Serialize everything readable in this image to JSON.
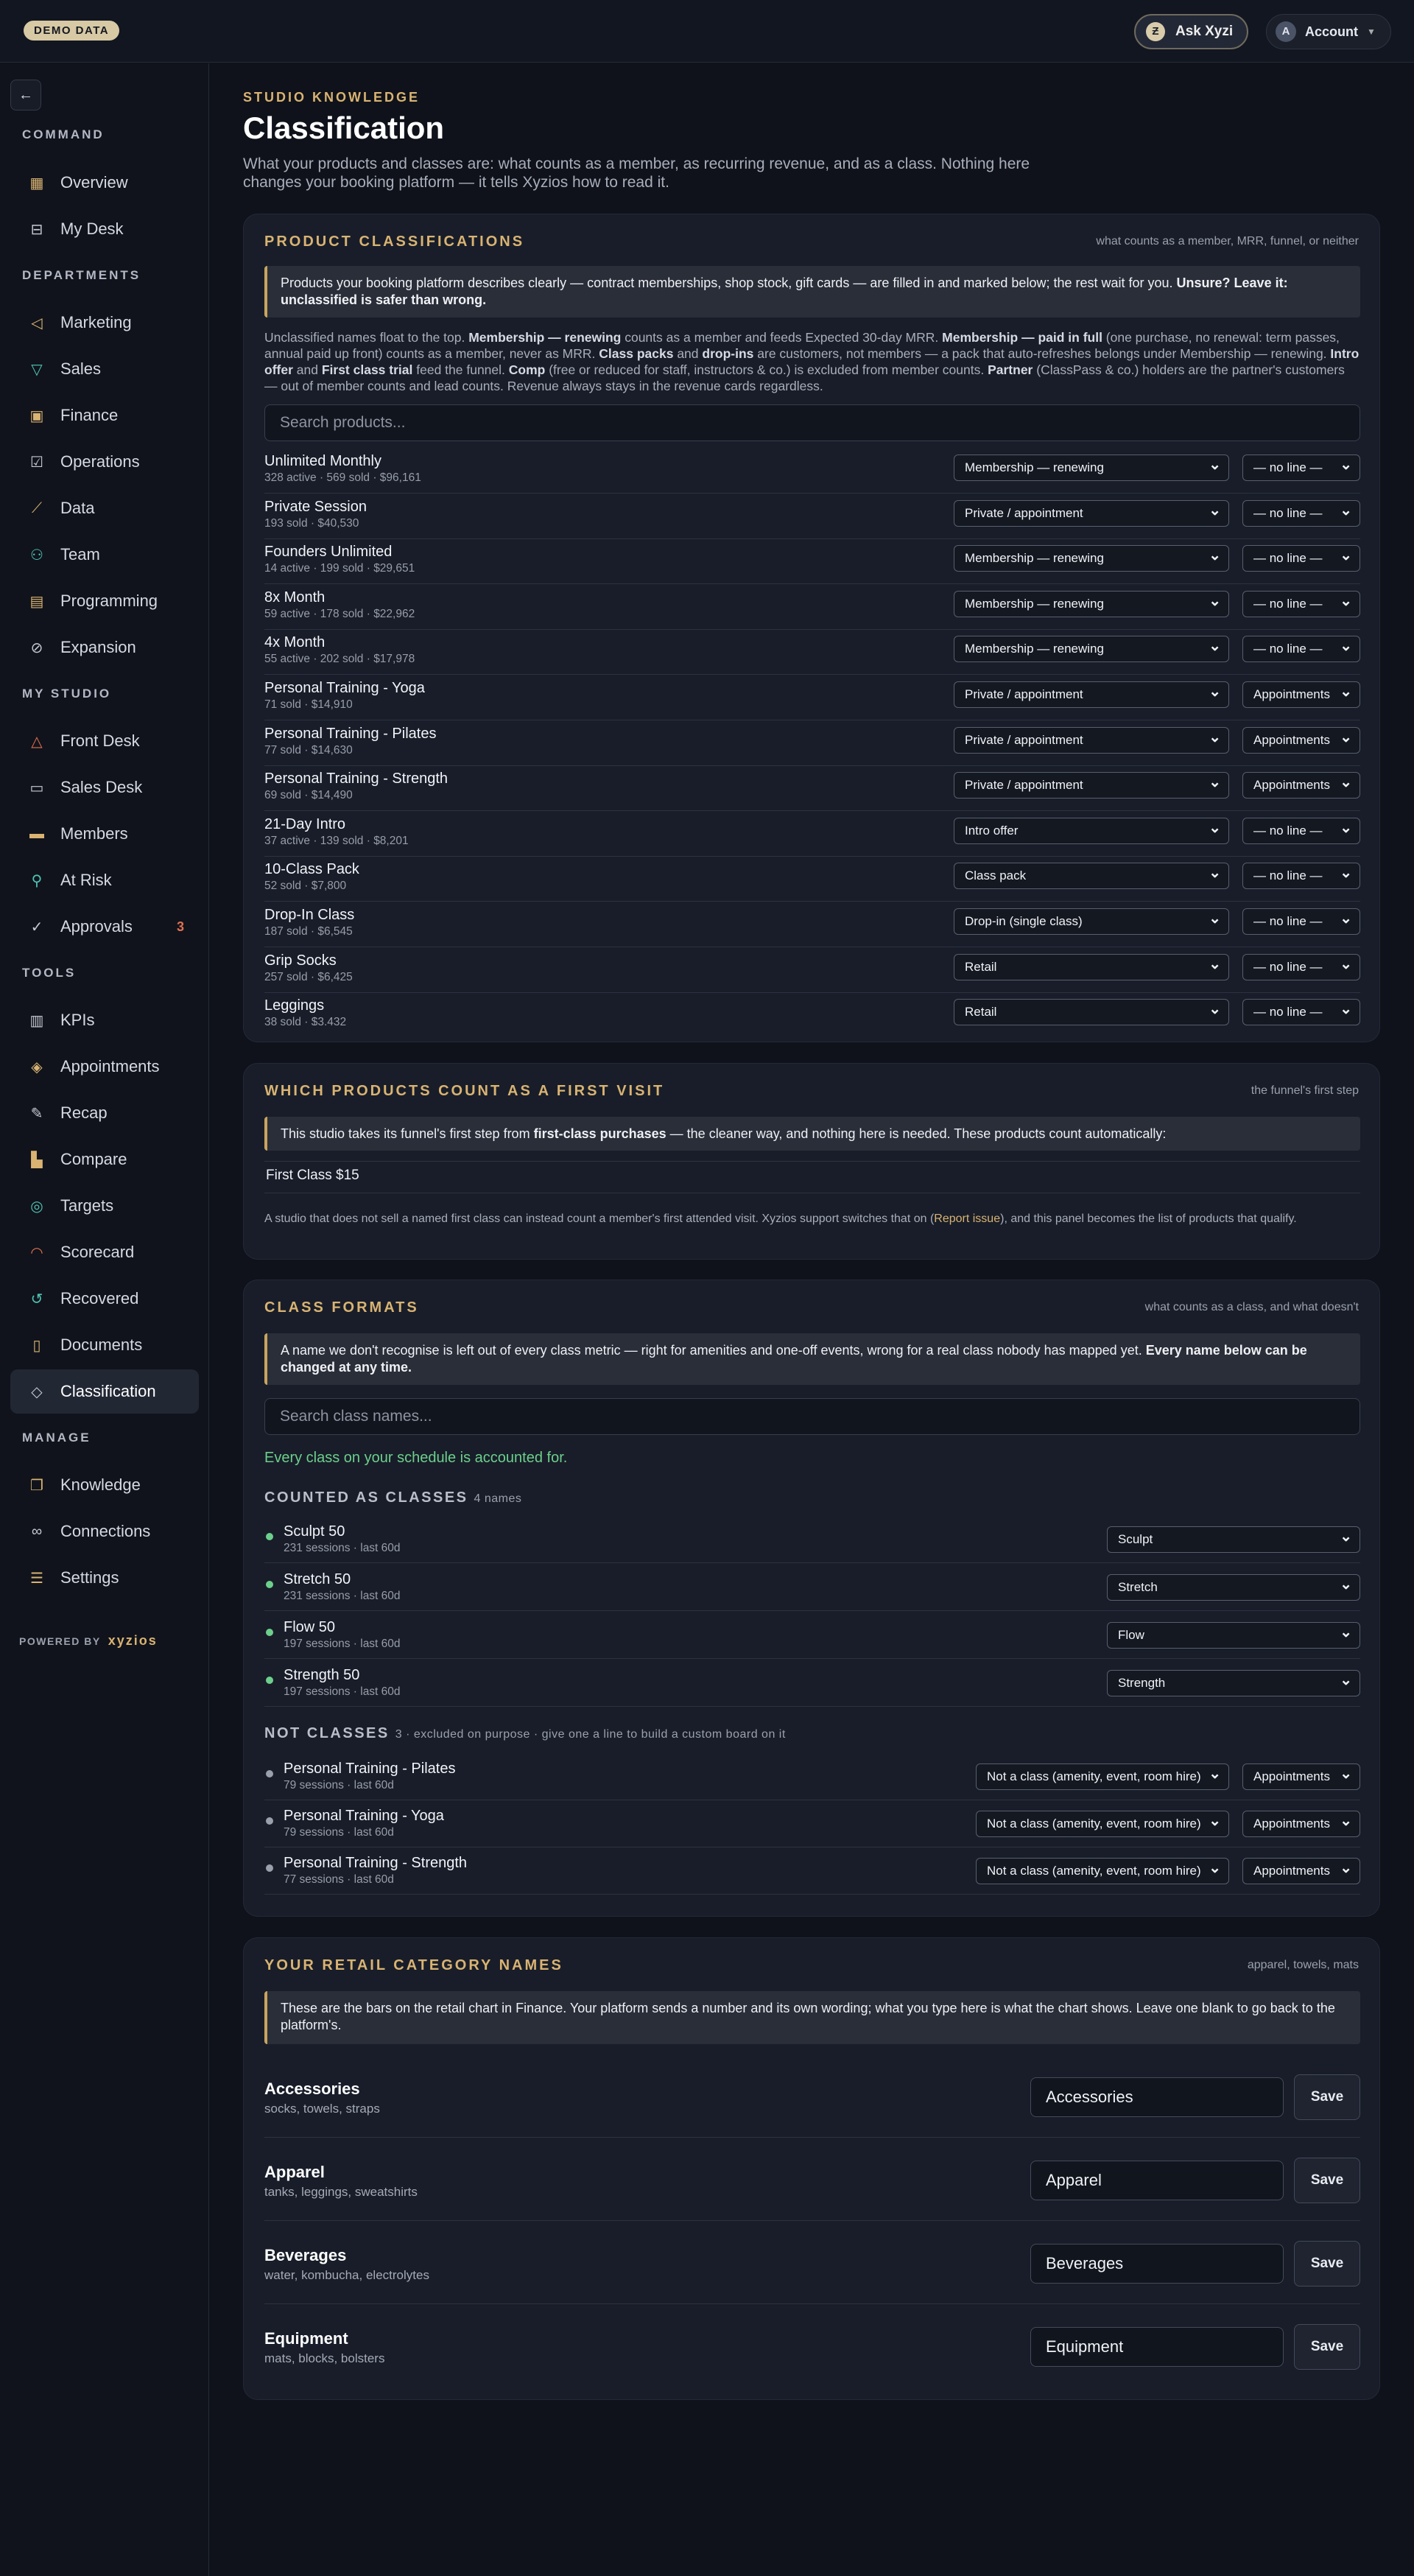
{
  "topbar": {
    "demo_badge": "DEMO DATA",
    "ask_label": "Ask Xyzi",
    "account_initial": "A",
    "account_label": "Account"
  },
  "sidebar": {
    "sections": {
      "command": "COMMAND",
      "departments": "DEPARTMENTS",
      "my_studio": "MY STUDIO",
      "tools": "TOOLS",
      "manage": "MANAGE"
    },
    "items": [
      {
        "label": "Overview",
        "icon": "grid-icon"
      },
      {
        "label": "My Desk",
        "icon": "inbox-icon"
      },
      {
        "label": "Marketing",
        "icon": "megaphone-icon"
      },
      {
        "label": "Sales",
        "icon": "funnel-icon"
      },
      {
        "label": "Finance",
        "icon": "banknote-icon"
      },
      {
        "label": "Operations",
        "icon": "clipboard-check-icon"
      },
      {
        "label": "Data",
        "icon": "line-chart-icon"
      },
      {
        "label": "Team",
        "icon": "users-icon"
      },
      {
        "label": "Programming",
        "icon": "calendar-icon"
      },
      {
        "label": "Expansion",
        "icon": "compass-icon"
      },
      {
        "label": "Front Desk",
        "icon": "bell-icon"
      },
      {
        "label": "Sales Desk",
        "icon": "chat-icon"
      },
      {
        "label": "Members",
        "icon": "id-card-icon"
      },
      {
        "label": "At Risk",
        "icon": "user-alert-icon"
      },
      {
        "label": "Approvals",
        "icon": "check-circle-icon",
        "badge": "3"
      },
      {
        "label": "KPIs",
        "icon": "bars-icon"
      },
      {
        "label": "Appointments",
        "icon": "layers-icon"
      },
      {
        "label": "Recap",
        "icon": "pencil-square-icon"
      },
      {
        "label": "Compare",
        "icon": "bar-chart-icon"
      },
      {
        "label": "Targets",
        "icon": "target-icon"
      },
      {
        "label": "Scorecard",
        "icon": "gauge-icon"
      },
      {
        "label": "Recovered",
        "icon": "refresh-circle-icon"
      },
      {
        "label": "Documents",
        "icon": "document-icon"
      },
      {
        "label": "Classification",
        "icon": "tag-icon"
      },
      {
        "label": "Knowledge",
        "icon": "book-icon"
      },
      {
        "label": "Connections",
        "icon": "link-icon"
      },
      {
        "label": "Settings",
        "icon": "sliders-icon"
      }
    ],
    "powered_by": "POWERED BY",
    "brand": "xyzios"
  },
  "page": {
    "eyebrow": "STUDIO KNOWLEDGE",
    "title": "Classification",
    "subtitle": "What your products and classes are: what counts as a member, as recurring revenue, and as a class. Nothing here changes your booking platform — it tells Xyzios how to read it."
  },
  "products": {
    "heading": "PRODUCT CLASSIFICATIONS",
    "right_note": "what counts as a member, MRR, funnel, or neither",
    "callout_text": "Products your booking platform describes clearly — contract memberships, shop stock, gift cards — are filled in and marked below; the rest wait for you. ",
    "callout_bold": "Unsure? Leave it: unclassified is safer than wrong.",
    "help_parts": [
      "Unclassified names float to the top. ",
      "Membership — renewing",
      " counts as a member and feeds Expected 30-day MRR. ",
      "Membership — paid in full",
      " (one purchase, no renewal: term passes, annual paid up front) counts as a member, never as MRR. ",
      "Class packs",
      " and ",
      "drop-ins",
      " are customers, not members — a pack that auto-refreshes belongs under Membership — renewing. ",
      "Intro offer",
      " and ",
      "First class trial",
      " feed the funnel. ",
      "Comp",
      " (free or reduced for staff, instructors & co.) is excluded from member counts. ",
      "Partner",
      " (ClassPass & co.) holders are the partner's customers — out of member counts and lead counts. Revenue always stays in the revenue cards regardless."
    ],
    "search_placeholder": "Search products...",
    "rows": [
      {
        "name": "Unlimited Monthly",
        "meta": "328 active · 569 sold · $96,161",
        "type": "Membership — renewing",
        "line": "— no line —"
      },
      {
        "name": "Private Session",
        "meta": "193 sold · $40,530",
        "type": "Private / appointment",
        "line": "— no line —"
      },
      {
        "name": "Founders Unlimited",
        "meta": "14 active · 199 sold · $29,651",
        "type": "Membership — renewing",
        "line": "— no line —"
      },
      {
        "name": "8x Month",
        "meta": "59 active · 178 sold · $22,962",
        "type": "Membership — renewing",
        "line": "— no line —"
      },
      {
        "name": "4x Month",
        "meta": "55 active · 202 sold · $17,978",
        "type": "Membership — renewing",
        "line": "— no line —"
      },
      {
        "name": "Personal Training - Yoga",
        "meta": "71 sold · $14,910",
        "type": "Private / appointment",
        "line": "Appointments"
      },
      {
        "name": "Personal Training - Pilates",
        "meta": "77 sold · $14,630",
        "type": "Private / appointment",
        "line": "Appointments"
      },
      {
        "name": "Personal Training - Strength",
        "meta": "69 sold · $14,490",
        "type": "Private / appointment",
        "line": "Appointments"
      },
      {
        "name": "21-Day Intro",
        "meta": "37 active · 139 sold · $8,201",
        "type": "Intro offer",
        "line": "— no line —"
      },
      {
        "name": "10-Class Pack",
        "meta": "52 sold · $7,800",
        "type": "Class pack",
        "line": "— no line —"
      },
      {
        "name": "Drop-In Class",
        "meta": "187 sold · $6,545",
        "type": "Drop-in (single class)",
        "line": "— no line —"
      },
      {
        "name": "Grip Socks",
        "meta": "257 sold · $6,425",
        "type": "Retail",
        "line": "— no line —"
      },
      {
        "name": "Leggings",
        "meta": "38 sold · $3,432",
        "type": "Retail",
        "line": "— no line —"
      }
    ]
  },
  "first_visit": {
    "heading": "WHICH PRODUCTS COUNT AS A FIRST VISIT",
    "right_note": "the funnel's first step",
    "callout_pre": "This studio takes its funnel's first step from ",
    "callout_bold": "first-class purchases",
    "callout_post": " — the cleaner way, and nothing here is needed. These products count automatically:",
    "item": "First Class $15",
    "note_pre": "A studio that does not sell a named first class can instead count a member's first attended visit. Xyzios support switches that on (",
    "note_link": "Report issue",
    "note_post": "), and this panel becomes the list of products that qualify."
  },
  "class_formats": {
    "heading": "CLASS FORMATS",
    "right_note": "what counts as a class, and what doesn't",
    "callout_text": "A name we don't recognise is left out of every class metric — right for amenities and one-off events, wrong for a real class nobody has mapped yet. ",
    "callout_bold": "Every name below can be changed at any time.",
    "search_placeholder": "Search class names...",
    "ok_message": "Every class on your schedule is accounted for.",
    "counted_title": "COUNTED AS CLASSES",
    "counted_count": "4 names",
    "counted": [
      {
        "name": "Sculpt 50",
        "meta": "231 sessions · last 60d",
        "format": "Sculpt"
      },
      {
        "name": "Stretch 50",
        "meta": "231 sessions · last 60d",
        "format": "Stretch"
      },
      {
        "name": "Flow 50",
        "meta": "197 sessions · last 60d",
        "format": "Flow"
      },
      {
        "name": "Strength 50",
        "meta": "197 sessions · last 60d",
        "format": "Strength"
      }
    ],
    "not_title": "NOT CLASSES",
    "not_note": "3 · excluded on purpose · give one a line to build a custom board on it",
    "not_classes": [
      {
        "name": "Personal Training - Pilates",
        "meta": "79 sessions · last 60d",
        "format": "Not a class (amenity, event, room hire)",
        "line": "Appointments"
      },
      {
        "name": "Personal Training - Yoga",
        "meta": "79 sessions · last 60d",
        "format": "Not a class (amenity, event, room hire)",
        "line": "Appointments"
      },
      {
        "name": "Personal Training - Strength",
        "meta": "77 sessions · last 60d",
        "format": "Not a class (amenity, event, room hire)",
        "line": "Appointments"
      }
    ]
  },
  "retail": {
    "heading": "YOUR RETAIL CATEGORY NAMES",
    "right_note": "apparel, towels, mats",
    "callout_text": "These are the bars on the retail chart in Finance. Your platform sends a number and its own wording; what you type here is what the chart shows. Leave one blank to go back to the platform's.",
    "save_label": "Save",
    "rows": [
      {
        "name": "Accessories",
        "meta": "socks, towels, straps",
        "value": "Accessories"
      },
      {
        "name": "Apparel",
        "meta": "tanks, leggings, sweatshirts",
        "value": "Apparel"
      },
      {
        "name": "Beverages",
        "meta": "water, kombucha, electrolytes",
        "value": "Beverages"
      },
      {
        "name": "Equipment",
        "meta": "mats, blocks, bolsters",
        "value": "Equipment"
      }
    ]
  }
}
